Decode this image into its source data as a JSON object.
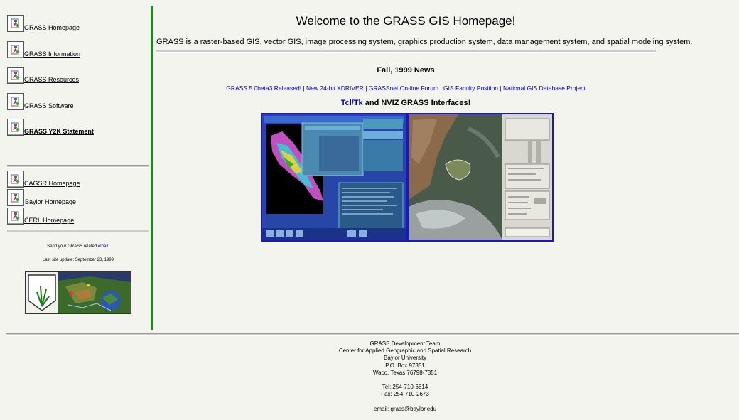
{
  "nav": {
    "items": [
      {
        "label": "GRASS Homepage"
      },
      {
        "label": "GRASS Information"
      },
      {
        "label": "GRASS Resources"
      },
      {
        "label": "GRASS Software"
      },
      {
        "label": "GRASS Y2K Statement"
      }
    ],
    "external": [
      {
        "label": "CAGSR Homepage"
      },
      {
        "label": "Baylor Homepage"
      },
      {
        "label": "CERL Homepage"
      }
    ],
    "send_prefix": "Send your GRASS related ",
    "send_link": "email",
    "send_suffix": ".",
    "last_update": "Last site update: September 23, 1999"
  },
  "main": {
    "title": "Welcome to the GRASS GIS Homepage!",
    "intro": "GRASS is a raster-based GIS, vector GIS, image processing system, graphics production system, data management system, and spatial modeling system.",
    "news_title": "Fall, 1999 News",
    "news_links": [
      "GRASS 5.0beta3 Released!",
      "New 24-bit XDRIVER",
      "GRASSnet On-line Forum",
      "GIS Faculty Position",
      "National GIS Database Project"
    ],
    "separator": "|",
    "interfaces_link": "Tcl/Tk",
    "interfaces_text": " and NVIZ GRASS Interfaces!"
  },
  "footer": {
    "lines": [
      "GRASS Development Team",
      "Center for Applied Geographic and Spatial Research",
      "Baylor University",
      "P.O. Box 97351",
      "Waco, Texas 76798-7351",
      "",
      "Tel: 254-710-6814",
      "Fax: 254-710-2673",
      "",
      "email: grass@baylor.edu"
    ]
  },
  "colors": {
    "background": "#f4f4ef",
    "divider_green": "#1a8a1a",
    "link_blue": "#0000cc",
    "frame_blue": "#1818c8"
  },
  "icons": {
    "nav_icon": "broken-image-icon",
    "logo": "grass-logo-icon"
  }
}
